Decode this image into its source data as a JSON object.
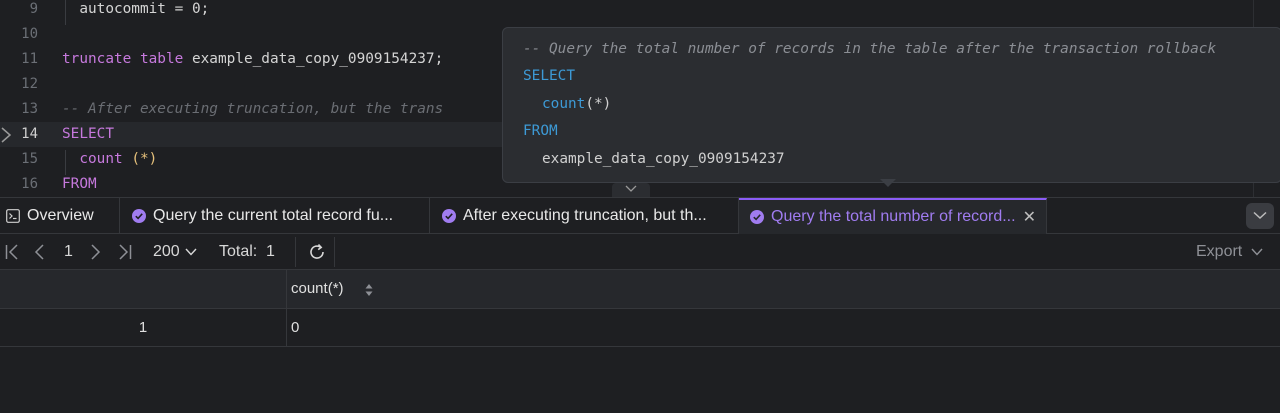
{
  "editor": {
    "lines": [
      {
        "num": "9",
        "tokens": [
          [
            "txt",
            "  autocommit = 0;"
          ]
        ]
      },
      {
        "num": "10",
        "tokens": []
      },
      {
        "num": "11",
        "tokens": [
          [
            "kw",
            "truncate"
          ],
          [
            "txt",
            " "
          ],
          [
            "kw",
            "table"
          ],
          [
            "txt",
            " example_data_copy_0909154237;"
          ]
        ]
      },
      {
        "num": "12",
        "tokens": []
      },
      {
        "num": "13",
        "tokens": [
          [
            "cm",
            "-- After executing truncation, but the trans"
          ]
        ]
      },
      {
        "num": "14",
        "tokens": [
          [
            "kw",
            "SELECT"
          ]
        ]
      },
      {
        "num": "15",
        "tokens": [
          [
            "txt",
            "  "
          ],
          [
            "kw",
            "count"
          ],
          [
            "fn",
            " (*)"
          ]
        ]
      },
      {
        "num": "16",
        "tokens": [
          [
            "kw",
            "FROM"
          ]
        ]
      }
    ]
  },
  "tooltip": {
    "comment": "-- Query the total number of records in the table after the transaction rollback",
    "select_kw": "SELECT",
    "count_fn": "count",
    "count_args": "(*)",
    "from_kw": "FROM",
    "table_name": "example_data_copy_0909154237"
  },
  "tabs": {
    "overview": "Overview",
    "items": [
      {
        "label": "Query the current total record fu..."
      },
      {
        "label": "After executing truncation, but th..."
      },
      {
        "label": "Query the total number of record..."
      }
    ],
    "close_glyph": "✕"
  },
  "toolbar": {
    "page": "1",
    "page_size": "200",
    "total_label": "Total:",
    "total_value": "1",
    "export_label": "Export"
  },
  "grid": {
    "columns": [
      "count(*)"
    ],
    "rows": [
      {
        "num": "1",
        "values": [
          "0"
        ]
      }
    ]
  },
  "colors": {
    "accent": "#8b5cf6",
    "keyword": "#c679dd",
    "tooltip_keyword": "#3d9ad6",
    "background": "#1e1f22"
  }
}
